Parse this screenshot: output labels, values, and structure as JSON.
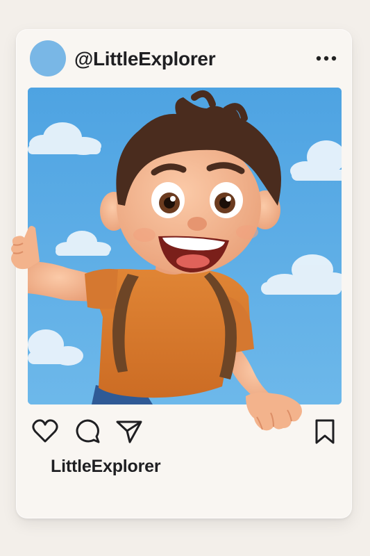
{
  "post": {
    "username": "@LittleExplorer",
    "caption_username": "LittleExplorer",
    "avatar_color": "#79b7e6"
  },
  "icons": {
    "more": "more-options-icon",
    "like": "heart-icon",
    "comment": "comment-icon",
    "share": "send-icon",
    "save": "bookmark-icon"
  },
  "image": {
    "subject": "cartoon-boy-waving",
    "sky_color": "#55a9e4",
    "shirt_color": "#d97a2e",
    "hair_color": "#4a2c1e"
  }
}
